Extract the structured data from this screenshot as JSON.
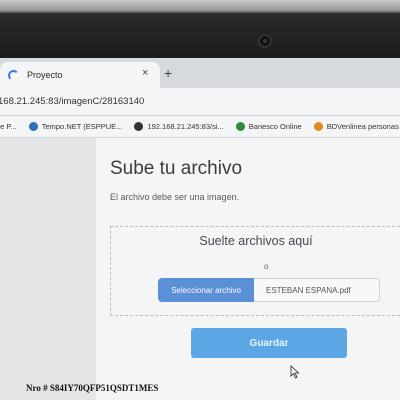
{
  "browser": {
    "tab_title": "Proyecto",
    "tab_close": "×",
    "new_tab": "+",
    "url": "168.21.245:83/imagenC/28163140",
    "bookmarks": [
      {
        "label": "de P...",
        "color": "#d8a030"
      },
      {
        "label": "Tempo.NET (ESPPUE...",
        "color": "#2f6fc1"
      },
      {
        "label": "192.168.21.245:83/si...",
        "color": "#333333"
      },
      {
        "label": "Banesco Online",
        "color": "#2f8a3e"
      },
      {
        "label": "BDVenlinea personas",
        "color": "#e08a1e"
      }
    ]
  },
  "upload": {
    "title": "Sube tu archivo",
    "subtitle": "El archivo debe ser una imagen.",
    "drop_title": "Suelte archivos aquí",
    "or_text": "o",
    "select_button": "Seleccionar archivo",
    "file_name": "ESTEBAN ESPANA.pdf",
    "save_button": "Guardar"
  },
  "caption": "Nro # S84IY70QFP51QSDT1MES",
  "colors": {
    "accent": "#5b8fd6",
    "save_button": "#5ba7e6"
  }
}
